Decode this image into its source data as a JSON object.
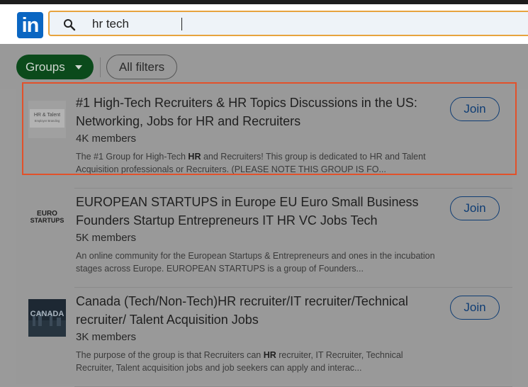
{
  "header": {
    "logo_text": "in",
    "search": {
      "value": "hr tech",
      "placeholder": ""
    }
  },
  "filters": {
    "groups_label": "Groups",
    "all_filters_label": "All filters"
  },
  "results": [
    {
      "title": "#1 High-Tech Recruiters & HR Topics Discussions in the US: Networking, Jobs for HR and Recruiters",
      "members": "4K members",
      "desc_before": "The #1 Group for High-Tech ",
      "desc_bold": "HR",
      "desc_after": " and Recruiters! This group is dedicated to HR and Talent Acquisition professionals or Recruiters. (PLEASE NOTE THIS GROUP IS FO...",
      "join_label": "Join",
      "thumb_text_1": "HR & Talent",
      "thumb_text_2": "Employer Branding"
    },
    {
      "title": "EUROPEAN STARTUPS in Europe EU Euro Small Business Founders Startup Entrepreneurs IT HR VC Jobs Tech",
      "members": "5K members",
      "desc_before": "An online community for the European Startups & Entrepreneurs and ones in the incubation stages across Europe. EUROPEAN STARTUPS is a group of Founders...",
      "desc_bold": "",
      "desc_after": "",
      "join_label": "Join",
      "thumb_text_1": "EURO",
      "thumb_text_2": "STARTUPS"
    },
    {
      "title": "Canada (Tech/Non-Tech)HR recruiter/IT recruiter/Technical recruiter/ Talent Acquisition Jobs",
      "members": "3K members",
      "desc_before": "The purpose of the group is that Recruiters can ",
      "desc_bold": "HR",
      "desc_after": " recruiter, IT Recruiter, Technical Recruiter, Talent acquisition jobs and job seekers can apply and interac...",
      "join_label": "Join",
      "thumb_text_1": "CANADA",
      "thumb_text_2": ""
    }
  ]
}
